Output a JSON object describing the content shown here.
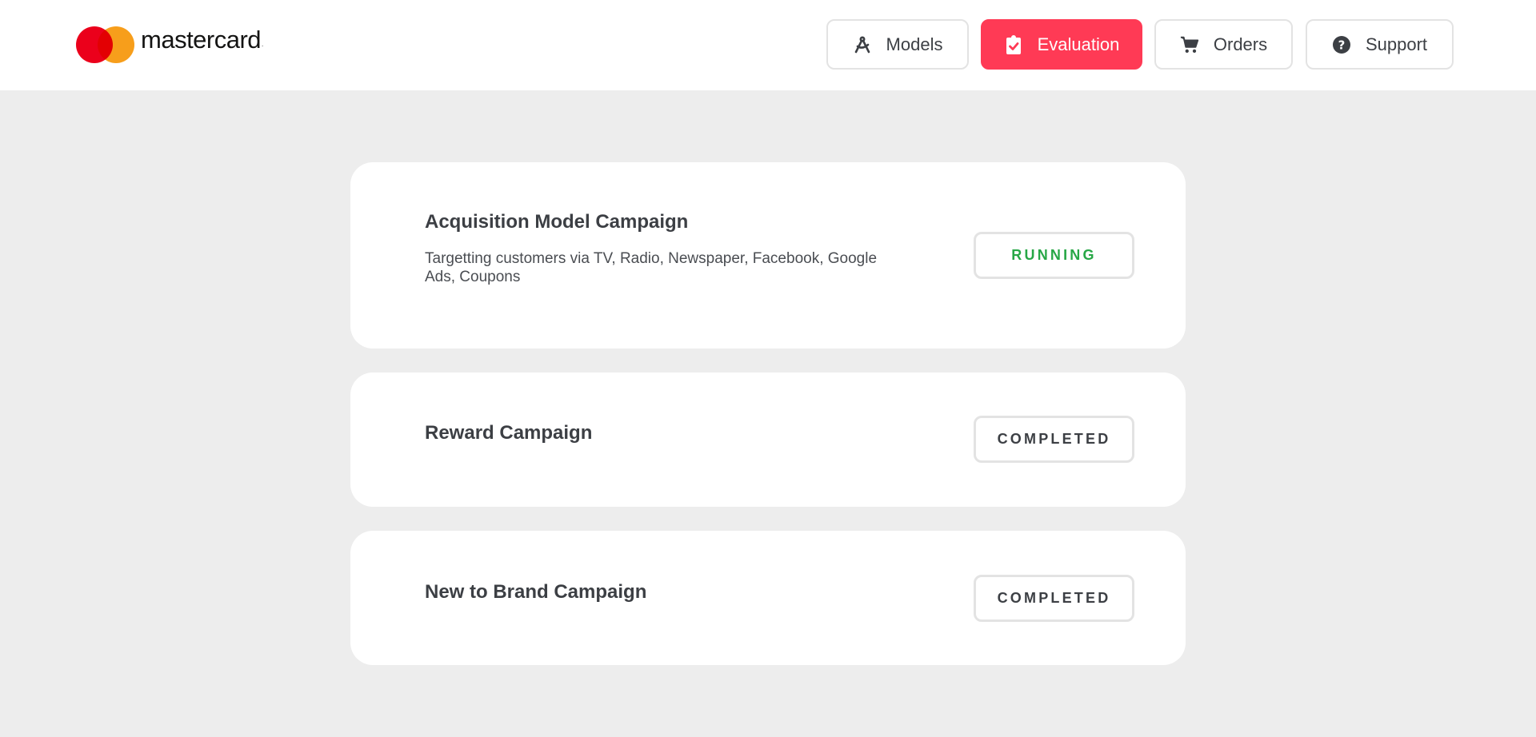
{
  "brand": {
    "name": "mastercard",
    "colors": {
      "red": "#eb001b",
      "orange": "#f79e1b",
      "accent": "#ff3a55"
    }
  },
  "nav": {
    "items": [
      {
        "label": "Models",
        "icon": "drafting-compass-icon"
      },
      {
        "label": "Evaluation",
        "icon": "clipboard-check-icon",
        "active": true
      },
      {
        "label": "Orders",
        "icon": "shopping-cart-icon"
      },
      {
        "label": "Support",
        "icon": "question-circle-icon"
      }
    ]
  },
  "campaigns": [
    {
      "title": "Acquisition Model Campaign",
      "description": "Targetting customers via TV, Radio, Newspaper, Facebook, Google Ads, Coupons",
      "status": "RUNNING",
      "status_color": "#27a746"
    },
    {
      "title": "Reward Campaign",
      "description": "",
      "status": "COMPLETED",
      "status_color": "#3c3f44"
    },
    {
      "title": "New to Brand Campaign",
      "description": "",
      "status": "COMPLETED",
      "status_color": "#3c3f44"
    }
  ]
}
